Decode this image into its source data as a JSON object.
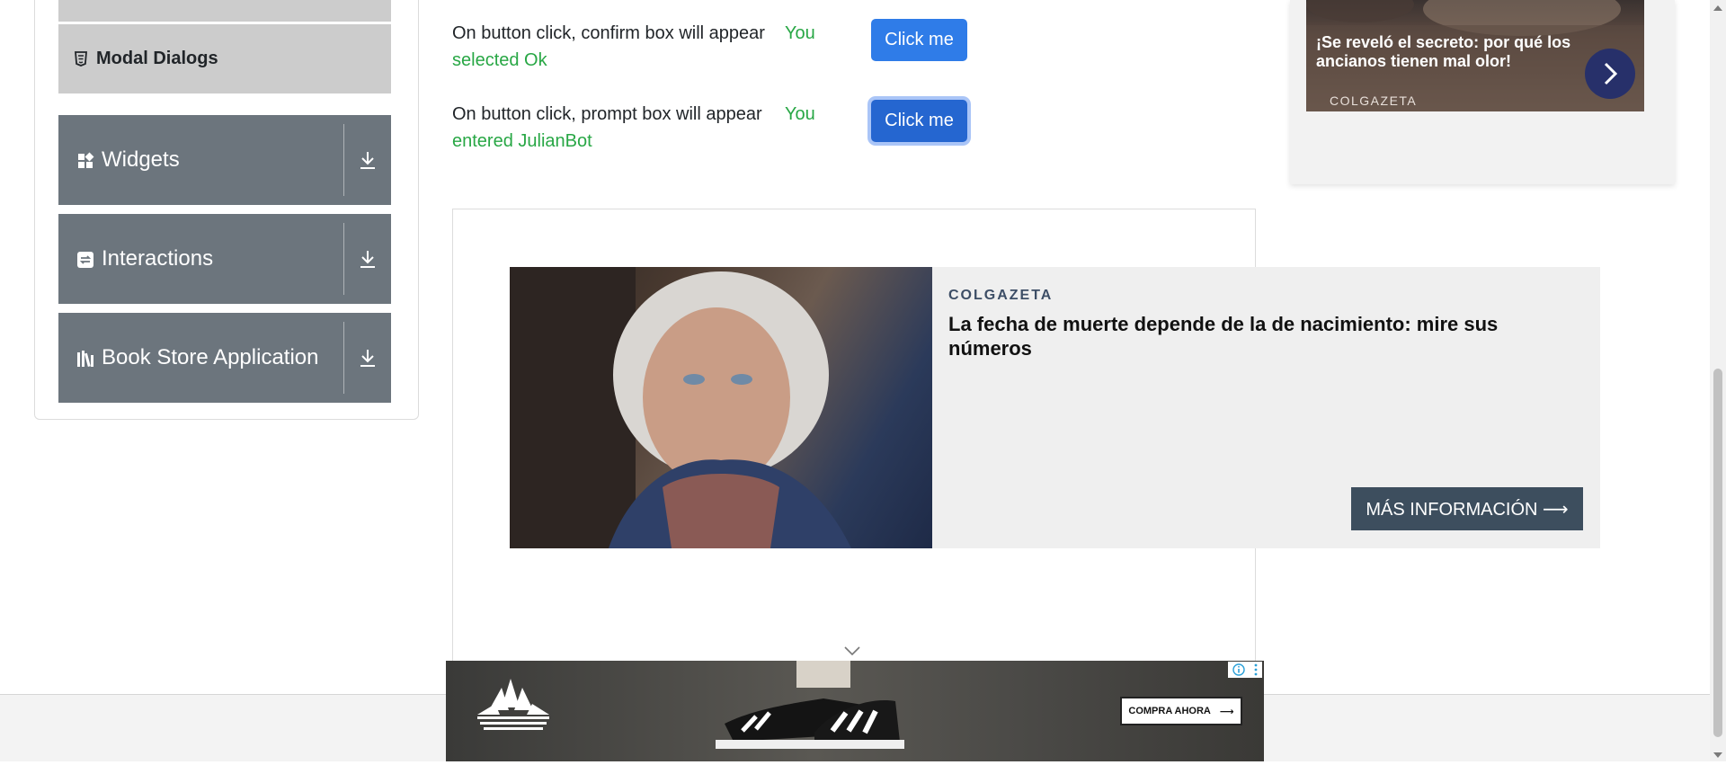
{
  "sidebar": {
    "active_item": {
      "label": "Modal Dialogs",
      "icon": "html5-icon"
    },
    "groups": [
      {
        "label": "Widgets",
        "icon": "widgets-icon"
      },
      {
        "label": "Interactions",
        "icon": "interactions-icon"
      },
      {
        "label": "Book Store Application",
        "icon": "books-icon"
      }
    ]
  },
  "alerts": {
    "confirm": {
      "text": "On button click, confirm box will appear",
      "result_line1": "You",
      "result_line2": "selected Ok",
      "button": "Click me"
    },
    "prompt": {
      "text": "On button click, prompt box will appear",
      "result_line1": "You",
      "result_line2": "entered JulianBot",
      "button": "Click me"
    }
  },
  "ad_right": {
    "title": "¡Se reveló el secreto: por qué los ancianos tienen mal olor!",
    "brand": "COLGAZETA"
  },
  "ad_middle": {
    "brand": "COLGAZETA",
    "title": "La fecha de muerte depende de la de nacimiento: mire sus números",
    "cta": "MÁS INFORMACIÓN ⟶"
  },
  "ad_bottom": {
    "cta": "COMPRA AHORA",
    "cta_arrow": "⟶"
  },
  "colors": {
    "primary_button": "#2f7ce8",
    "success_text": "#28a745",
    "sidebar_group": "#6c757d",
    "sidebar_active": "#cccccc"
  }
}
